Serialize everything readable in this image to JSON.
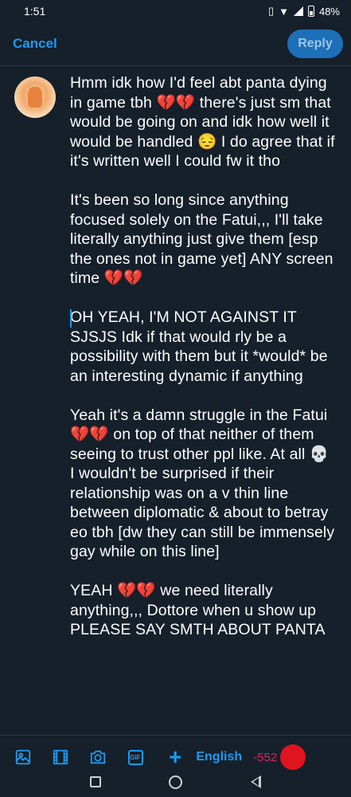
{
  "status_bar": {
    "time": "1:51",
    "battery": "48%",
    "icons": [
      "vibrate-icon",
      "wifi-icon",
      "signal-icon",
      "battery-icon"
    ]
  },
  "header": {
    "cancel_label": "Cancel",
    "reply_label": "Reply"
  },
  "compose": {
    "text": "Hmm idk how I'd feel abt panta dying in game tbh 💔💔 there's just sm that would be going on and idk how well it would be handled 😔 I do agree that if it's written well I could fw it tho\n\nIt's been so long since anything focused solely on the Fatui,,, I'll take literally anything just give them [esp the ones not in game yet] ANY screen time 💔💔\n\nOH YEAH, I'M NOT AGAINST IT SJSJS Idk if that would rly be a possibility with them but it *would* be an interesting dynamic if anything\n\nYeah it's a damn struggle in the Fatui 💔💔 on top of that neither of them seeing to trust other ppl like. At all 💀 I wouldn't be surprised if their relationship was on a v thin line between diplomatic & about to betray eo tbh [dw they can still be immensely gay while on this line]\n\nYEAH 💔💔 we need literally anything,,, Dottore when u show up PLEASE SAY SMTH ABOUT PANTA"
  },
  "toolbar": {
    "icons": [
      "image-icon",
      "video-icon",
      "camera-icon",
      "gif-icon",
      "add-icon"
    ],
    "gif_label": "GIF",
    "plus_label": "+",
    "language": "English",
    "char_count": "-552",
    "accent": "#1d9bf0",
    "over_limit_color": "#e0245e"
  },
  "navbar": {
    "icons": [
      "recents-icon",
      "home-icon",
      "back-icon"
    ]
  }
}
